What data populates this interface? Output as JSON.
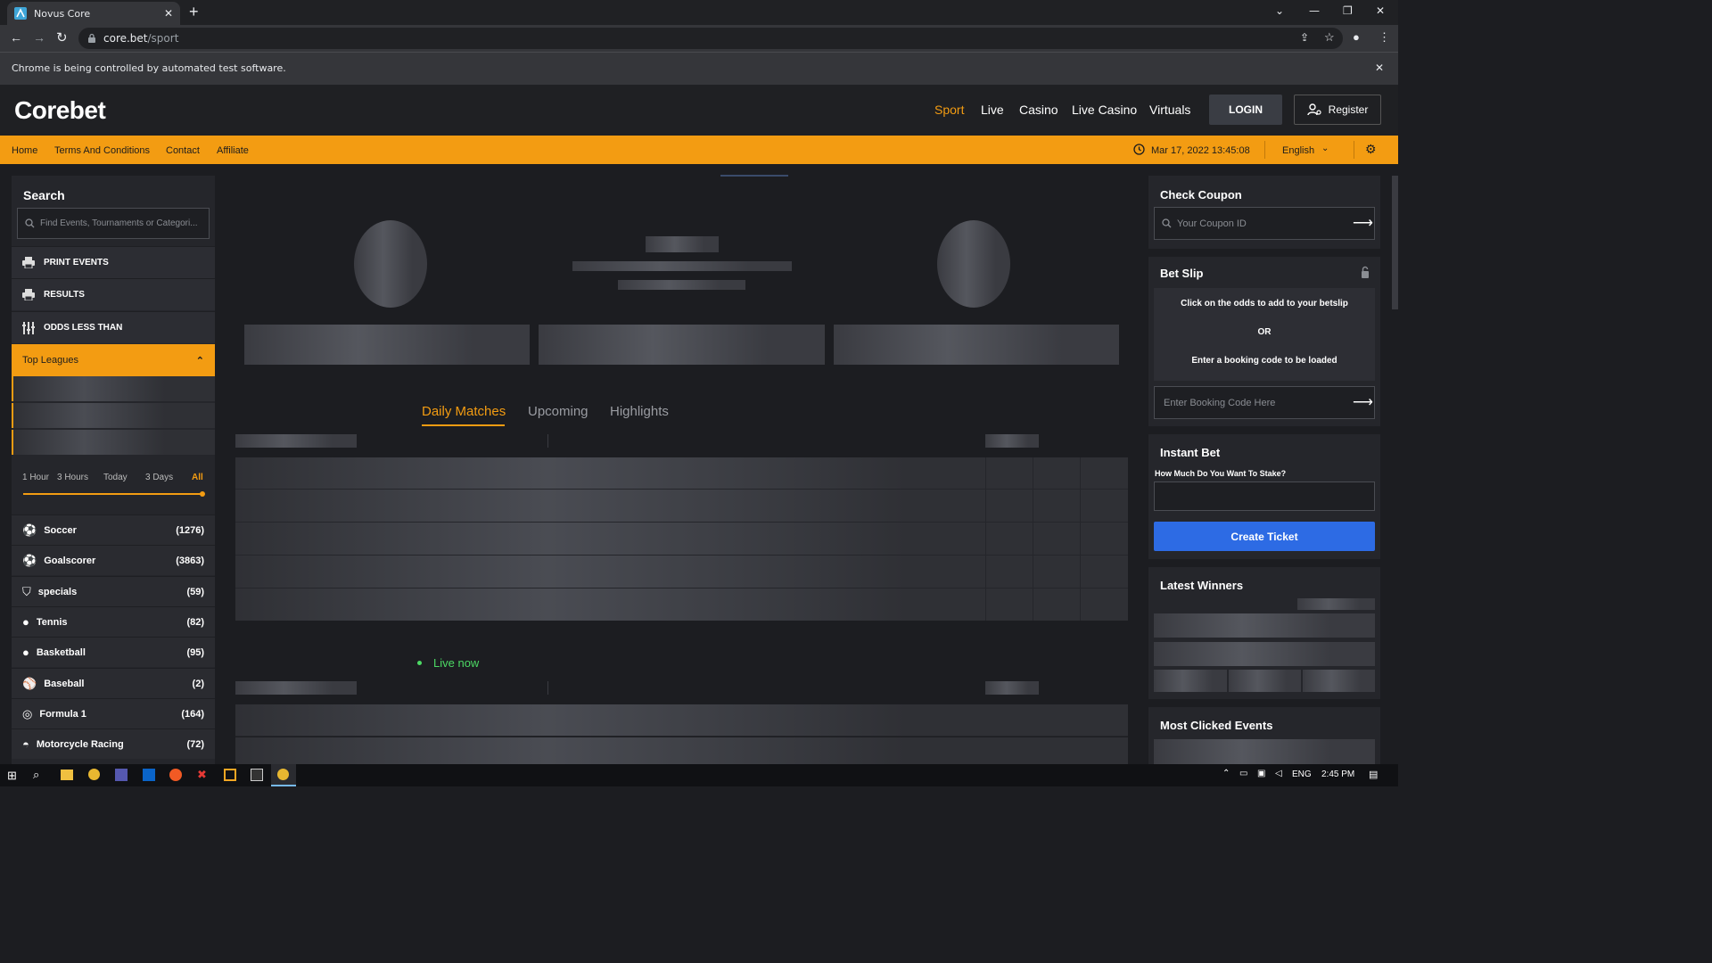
{
  "browser": {
    "tab_title": "Novus Core",
    "url_host": "core.bet",
    "url_path": "/sport",
    "infobar_text": "Chrome is being controlled by automated test software."
  },
  "header": {
    "logo": "Corebet",
    "nav": [
      "Sport",
      "Live",
      "Casino",
      "Live Casino",
      "Virtuals"
    ],
    "active_nav": "Sport",
    "login": "LOGIN",
    "register": "Register"
  },
  "subnav": {
    "links": [
      "Home",
      "Terms And Conditions",
      "Contact",
      "Affiliate"
    ],
    "datetime": "Mar 17, 2022 13:45:08",
    "language": "English"
  },
  "left": {
    "search_title": "Search",
    "search_placeholder": "Find Events, Tournaments or Categori...",
    "actions": [
      "PRINT EVENTS",
      "RESULTS",
      "ODDS LESS THAN"
    ],
    "top_leagues": "Top Leagues",
    "time_filters": [
      "1 Hour",
      "3 Hours",
      "Today",
      "3 Days",
      "All"
    ],
    "active_filter": "All",
    "sports": [
      {
        "name": "Soccer",
        "count": "(1276)"
      },
      {
        "name": "Goalscorer",
        "count": "(3863)"
      },
      {
        "name": "specials",
        "count": "(59)"
      },
      {
        "name": "Tennis",
        "count": "(82)"
      },
      {
        "name": "Basketball",
        "count": "(95)"
      },
      {
        "name": "Baseball",
        "count": "(2)"
      },
      {
        "name": "Formula 1",
        "count": "(164)"
      },
      {
        "name": "Motorcycle Racing",
        "count": "(72)"
      }
    ]
  },
  "center": {
    "tabs": [
      "Daily Matches",
      "Upcoming",
      "Highlights"
    ],
    "active_tab": "Daily Matches",
    "live_label": "Live now"
  },
  "right": {
    "check_coupon_title": "Check Coupon",
    "coupon_placeholder": "Your Coupon ID",
    "betslip_title": "Bet Slip",
    "betslip_line1": "Click on the odds to add to your betslip",
    "betslip_or": "OR",
    "betslip_line2": "Enter a booking code to be loaded",
    "booking_placeholder": "Enter Booking Code Here",
    "instant_title": "Instant Bet",
    "stake_label": "How Much Do You Want To Stake?",
    "create_ticket": "Create Ticket",
    "winners_title": "Latest Winners",
    "most_clicked_title": "Most Clicked Events"
  },
  "taskbar": {
    "lang": "ENG",
    "time": "2:45 PM"
  },
  "colors": {
    "accent": "#f39c12",
    "live_green": "#4cd964",
    "primary_blue": "#2d6be4"
  }
}
